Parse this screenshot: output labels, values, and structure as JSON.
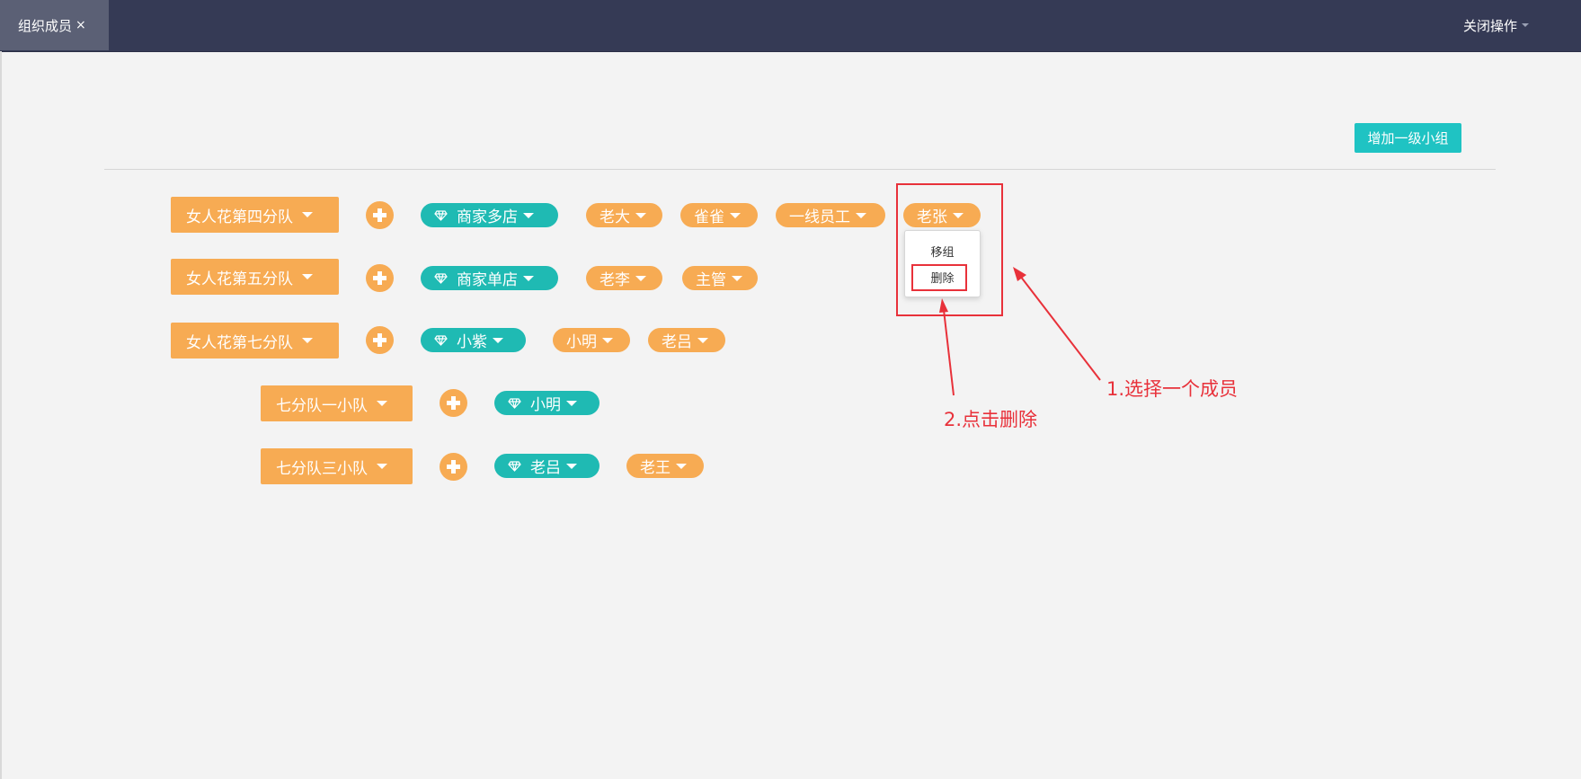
{
  "topbar": {
    "tab_label": "组织成员",
    "tab_close": "×",
    "close_ops_label": "关闭操作"
  },
  "toolbar": {
    "add_group_label": "增加一级小组"
  },
  "rows": [
    {
      "group": "女人花第四分队",
      "leader": "商家多店",
      "members": [
        "老大",
        "雀雀",
        "一线员工",
        "老张"
      ]
    },
    {
      "group": "女人花第五分队",
      "leader": "商家单店",
      "members": [
        "老李",
        "主管"
      ]
    },
    {
      "group": "女人花第七分队",
      "leader": "小紫",
      "members": [
        "小明",
        "老吕"
      ]
    },
    {
      "group": "七分队一小队",
      "leader": "小明",
      "members": []
    },
    {
      "group": "七分队三小队",
      "leader": "老吕",
      "members": [
        "老王"
      ]
    }
  ],
  "dropdown": {
    "move_label": "移组",
    "delete_label": "删除"
  },
  "annotations": {
    "step1": "1.选择一个成员",
    "step2": "2.点击删除",
    "color": "#e8313a"
  },
  "colors": {
    "accent_orange": "#f7ab53",
    "accent_teal": "#1fbab3",
    "topbar": "#353a55"
  }
}
